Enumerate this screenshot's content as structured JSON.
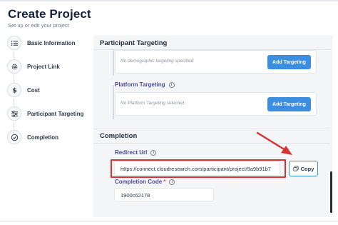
{
  "header": {
    "title": "Create Project",
    "subtitle": "Set up or edit your project"
  },
  "steps": [
    {
      "label": "Basic Information",
      "icon": "list-icon"
    },
    {
      "label": "Project Link",
      "icon": "gear-icon"
    },
    {
      "label": "Cost",
      "icon": "dollar-icon"
    },
    {
      "label": "Participant Targeting",
      "icon": "sliders-icon"
    },
    {
      "label": "Completion",
      "icon": "check-circle-icon"
    }
  ],
  "targeting": {
    "heading": "Participant Targeting",
    "demographic_empty": "No demographic targeting specified",
    "demographic_button": "Add Targeting",
    "platform_label": "Platform Targeting",
    "platform_empty": "No Platform Targeting selected",
    "platform_button": "Add Targeting"
  },
  "completion": {
    "heading": "Completion",
    "redirect_label": "Redirect Url",
    "redirect_value": "https://connect.cloudresearch.com/participant/project/9a9b91b7",
    "copy_label": "Copy",
    "code_label": "Completion Code",
    "code_required": "*",
    "code_value": "1900c62178"
  },
  "colors": {
    "primary_button": "#3b8ee0",
    "highlight": "#d63232",
    "annotation_arrow": "#d63232"
  }
}
